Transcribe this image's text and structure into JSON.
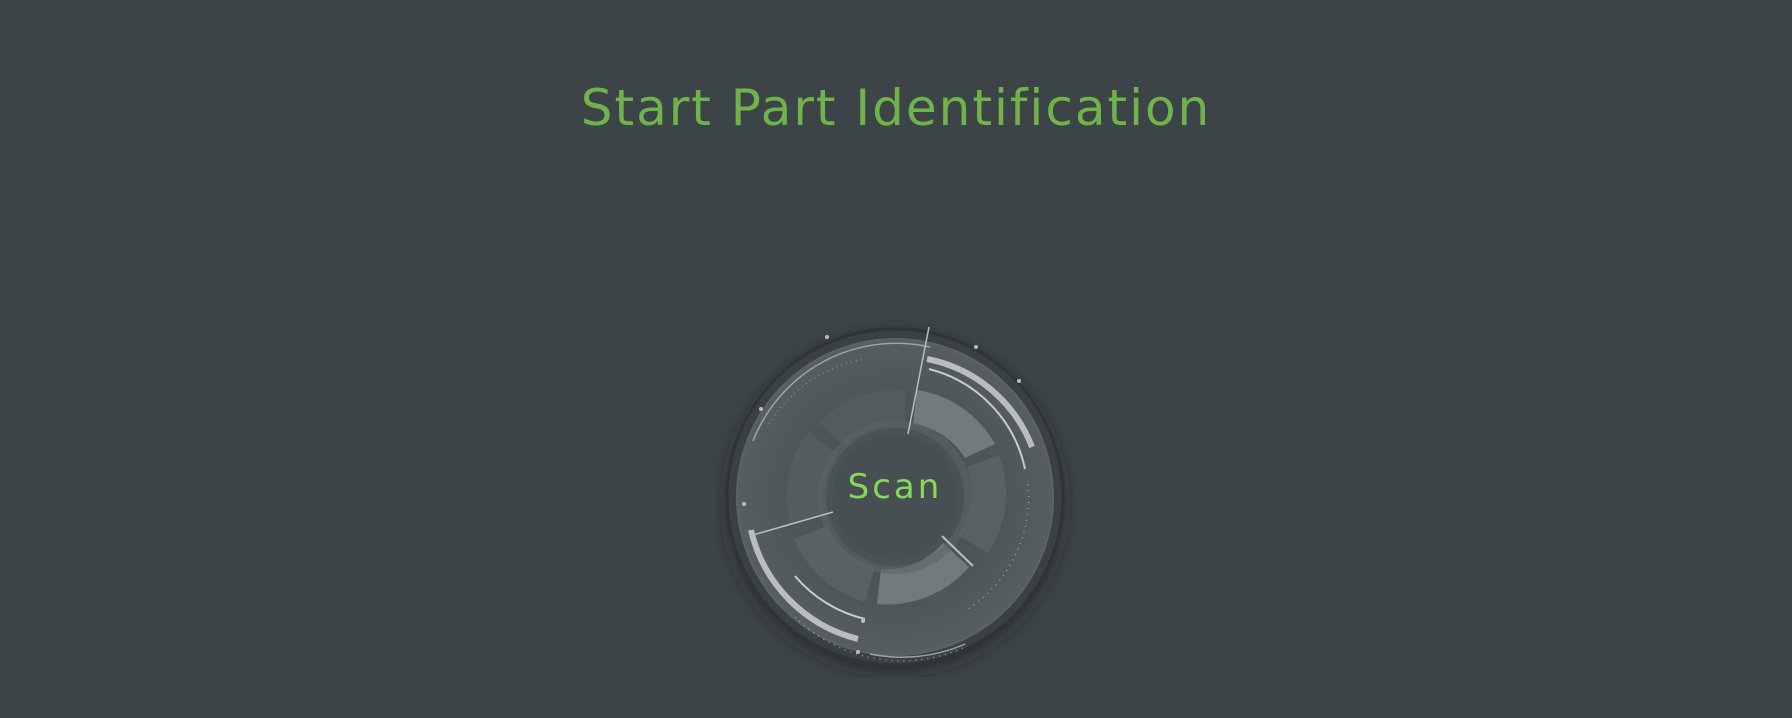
{
  "header": {
    "title": "Start Part Identification"
  },
  "scan_button": {
    "label": "Scan"
  },
  "colors": {
    "background": "#3d4447",
    "title": "#6fb34a",
    "scan_label": "#86d957",
    "dial_face": "#4c5457",
    "dial_segment": "#5a6265",
    "dial_segment_bright": "#747b7e",
    "dial_accent": "#b9bdbf"
  }
}
